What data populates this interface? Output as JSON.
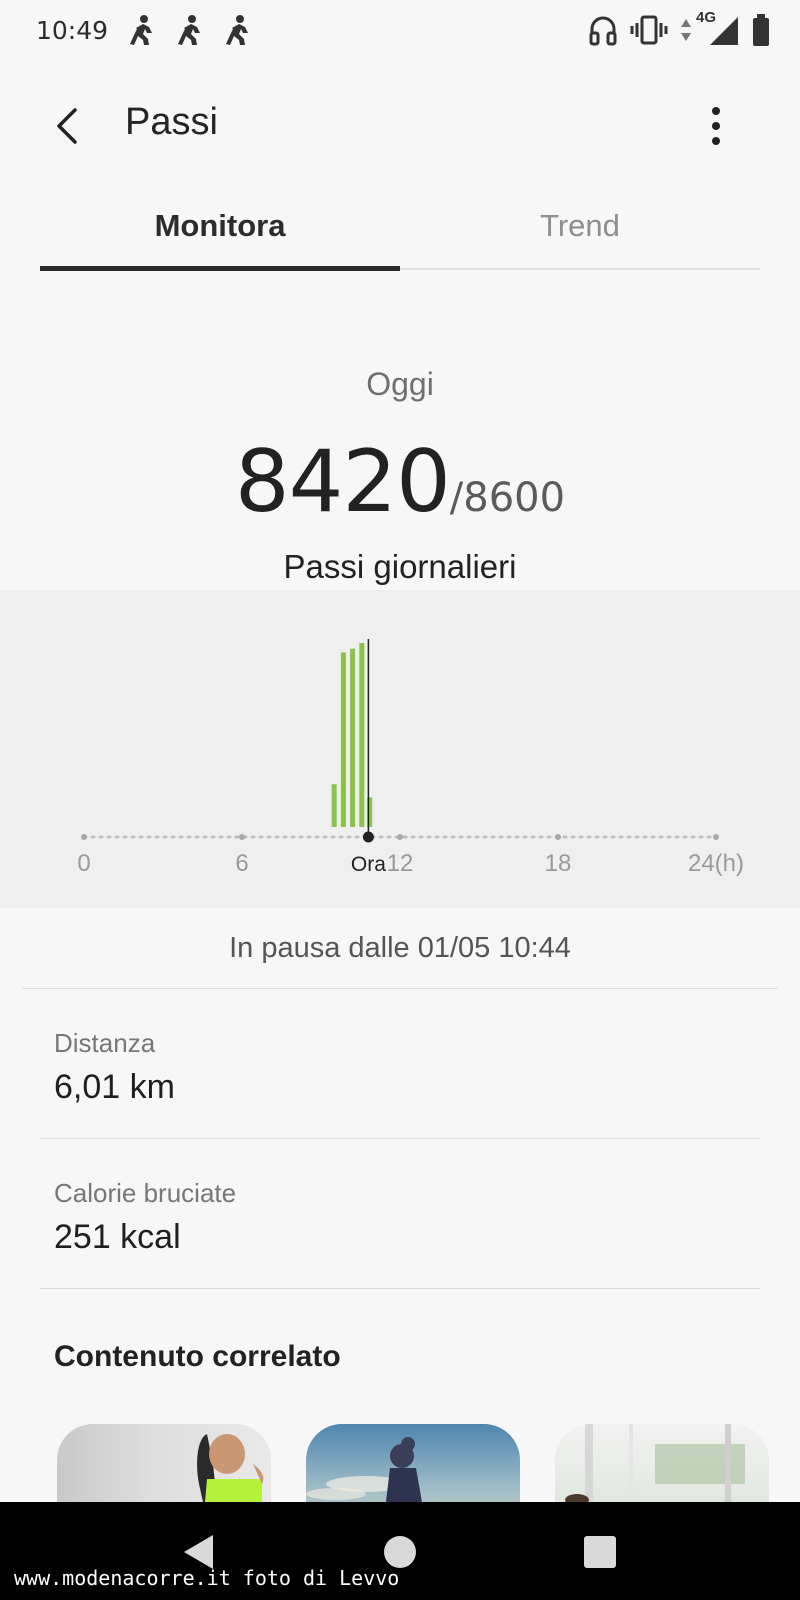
{
  "status_bar": {
    "time": "10:49",
    "network": "4G",
    "notification_icons": [
      "runner-icon",
      "runner-icon",
      "runner-icon"
    ],
    "right_icons": [
      "headphones-icon",
      "vibrate-icon",
      "data-arrows-icon",
      "signal-icon",
      "battery-icon"
    ]
  },
  "app_bar": {
    "title": "Passi",
    "back_icon": "chevron-left-icon",
    "menu_icon": "more-vertical-icon"
  },
  "tabs": [
    {
      "label": "Monitora",
      "selected": true
    },
    {
      "label": "Trend",
      "selected": false
    }
  ],
  "summary": {
    "period_label": "Oggi",
    "steps": "8420",
    "goal": "/8600",
    "caption": "Passi giornalieri"
  },
  "chart_data": {
    "type": "bar",
    "x_ticks": [
      "0",
      "6",
      "12",
      "18",
      "24(h)"
    ],
    "xlim": [
      0,
      24
    ],
    "now_label": "Ora",
    "now_hour": 10.8,
    "bar_color": "#8bc34a",
    "bars": [
      {
        "hour": 9.5,
        "value": 28
      },
      {
        "hour": 9.85,
        "value": 98
      },
      {
        "hour": 10.2,
        "value": 100
      },
      {
        "hour": 10.55,
        "value": 103
      },
      {
        "hour": 10.85,
        "value": 21
      }
    ],
    "grid": false
  },
  "paused_text": "In pausa dalle 01/05 10:44",
  "stats": [
    {
      "label": "Distanza",
      "value": "6,01 km"
    },
    {
      "label": "Calorie bruciate",
      "value": "251 kcal"
    }
  ],
  "related_content": {
    "title": "Contenuto correlato",
    "cards": [
      "workout-image",
      "running-image",
      "gym-image"
    ]
  },
  "nav_bar": {
    "buttons": [
      "back-triangle-icon",
      "home-circle-icon",
      "recents-square-icon"
    ],
    "watermark": "www.modenacorre.it foto di Levvo"
  },
  "colors": {
    "background": "#f7f7f7",
    "chart_panel": "#efefef",
    "accent_bar": "#8bc34a",
    "tab_indicator": "#2a2a2a"
  }
}
